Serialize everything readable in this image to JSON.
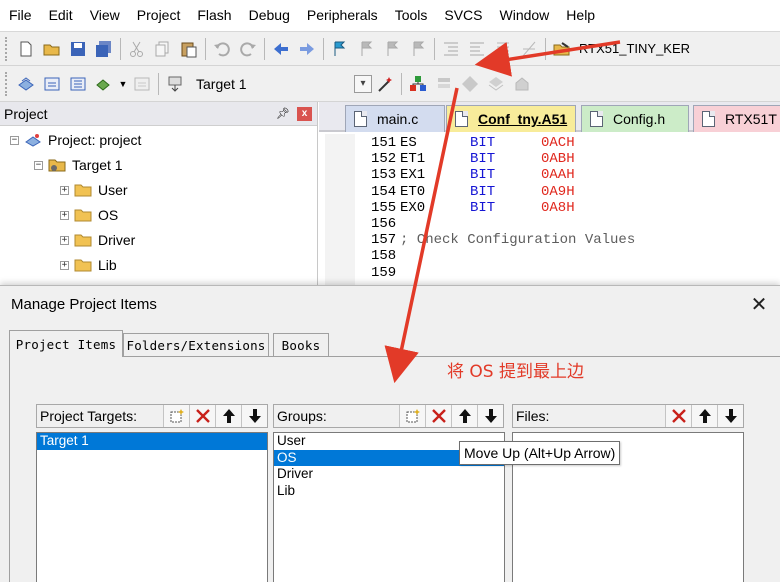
{
  "menubar": {
    "items": [
      "File",
      "Edit",
      "View",
      "Project",
      "Flash",
      "Debug",
      "Peripherals",
      "Tools",
      "SVCS",
      "Window",
      "Help"
    ]
  },
  "toolbar": {
    "project_name": "RTX51_TINY_KER",
    "target_select": {
      "value": "Target 1"
    }
  },
  "project_panel": {
    "title": "Project",
    "pin_icon": "pin-icon",
    "close_label": "x",
    "tree": {
      "root": "Project: project",
      "target": "Target 1",
      "groups": [
        "User",
        "OS",
        "Driver",
        "Lib"
      ],
      "expand_marker": "+",
      "collapse_marker": "−"
    }
  },
  "editor": {
    "tabs": [
      {
        "label": "main.c"
      },
      {
        "label": "Conf_tny.A51"
      },
      {
        "label": "Config.h"
      },
      {
        "label": "RTX51T"
      }
    ],
    "active_tab": "Conf_tny.A51",
    "lines": [
      {
        "num": "151",
        "label": "ES",
        "kw": "BIT",
        "val": "0ACH"
      },
      {
        "num": "152",
        "label": "ET1",
        "kw": "BIT",
        "val": "0ABH"
      },
      {
        "num": "153",
        "label": "EX1",
        "kw": "BIT",
        "val": "0AAH"
      },
      {
        "num": "154",
        "label": "ET0",
        "kw": "BIT",
        "val": "0A9H"
      },
      {
        "num": "155",
        "label": "EX0",
        "kw": "BIT",
        "val": "0A8H"
      },
      {
        "num": "156",
        "label": "",
        "kw": "",
        "val": ""
      },
      {
        "num": "157",
        "comment": "; Check Configuration Values"
      },
      {
        "num": "158",
        "label": "",
        "kw": "",
        "val": ""
      },
      {
        "num": "159",
        "label": "",
        "kw": "",
        "val": ""
      }
    ]
  },
  "dialog": {
    "title": "Manage Project Items",
    "close_label": "✕",
    "tabs": [
      "Project Items",
      "Folders/Extensions",
      "Books"
    ],
    "active_tab": "Project Items",
    "annotation": "将 OS 提到最上边",
    "targets": {
      "caption": "Project Targets:",
      "items": [
        "Target 1"
      ],
      "selected": "Target 1"
    },
    "groups": {
      "caption": "Groups:",
      "items": [
        "User",
        "OS",
        "Driver",
        "Lib"
      ],
      "selected": "OS"
    },
    "files": {
      "caption": "Files:",
      "items": []
    },
    "tooltip": "Move Up (Alt+Up Arrow)"
  },
  "colors": {
    "annotation_red": "#e23a28",
    "selection_blue": "#0078d7",
    "keyword_blue": "#1515d4",
    "value_red": "#e0281e",
    "active_tab_yellow": "#f8ec9a"
  }
}
